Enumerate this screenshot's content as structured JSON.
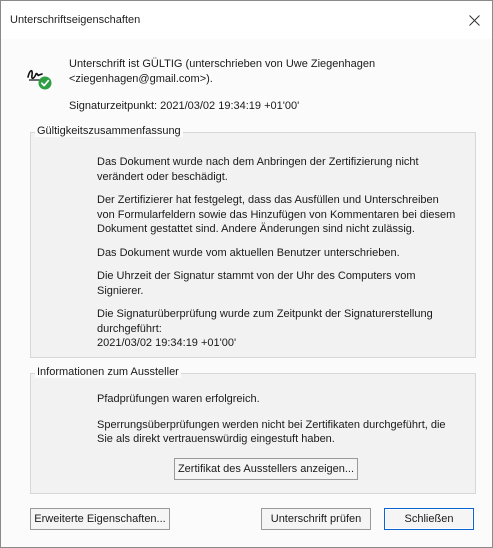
{
  "window": {
    "title": "Unterschriftseigenschaften"
  },
  "header": {
    "status": "Unterschrift ist GÜLTIG (unterschrieben von Uwe Ziegenhagen <ziegenhagen@gmail.com>).",
    "timestamp": "Signaturzeitpunkt:  2021/03/02 19:34:19 +01'00'"
  },
  "validity": {
    "title": "Gültigkeitszusammenfassung",
    "paragraphs": [
      "Das Dokument wurde nach dem Anbringen der Zertifizierung nicht verändert oder beschädigt.",
      "Der Zertifizierer hat festgelegt, dass das Ausfüllen und Unterschreiben von Formularfeldern sowie das Hinzufügen von Kommentaren bei diesem Dokument gestattet sind. Andere Änderungen sind nicht zulässig.",
      "Das Dokument wurde vom aktuellen Benutzer unterschrieben.",
      "Die Uhrzeit der Signatur stammt von der Uhr des Computers vom Signierer.",
      "Die Signaturüberprüfung wurde zum Zeitpunkt der Signaturerstellung durchgeführt:",
      "2021/03/02 19:34:19 +01'00'"
    ]
  },
  "issuer": {
    "title": "Informationen zum Aussteller",
    "paragraphs": [
      "Pfadprüfungen waren erfolgreich.",
      "Sperrungsüberprüfungen werden nicht bei Zertifikaten durchgeführt, die Sie als direkt vertrauenswürdig eingestuft haben."
    ],
    "show_cert_label": "Zertifikat des Ausstellers anzeigen..."
  },
  "footer": {
    "advanced_label": "Erweiterte Eigenschaften...",
    "verify_label": "Unterschrift prüfen",
    "close_label": "Schließen"
  },
  "icons": {
    "signature": "signature-valid-icon",
    "close": "close-icon"
  },
  "colors": {
    "valid_green": "#2ea043",
    "accent_blue": "#0a64d6"
  }
}
